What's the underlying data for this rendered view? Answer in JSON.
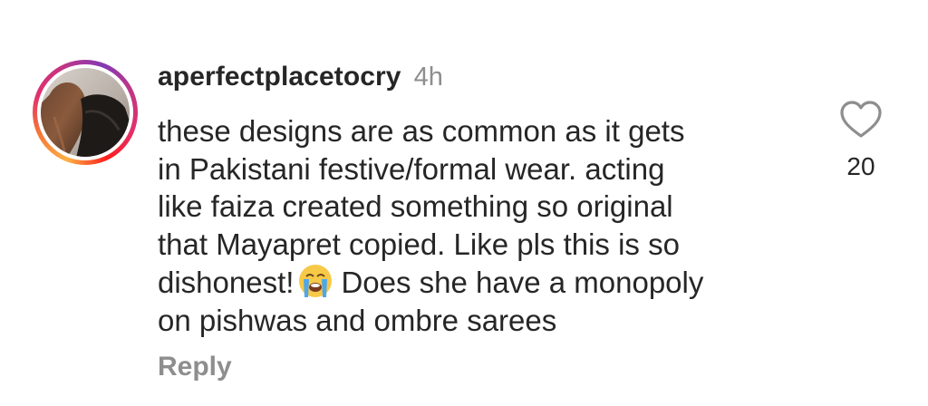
{
  "comment": {
    "username": "aperfectplacetocry",
    "time": "4h",
    "lines": [
      "these designs are as common as it gets",
      "in Pakistani festive/formal wear. acting",
      "like faiza created something so original",
      "that Mayapret copied. Like pls this is so",
      "dishonest!",
      "Does she have a monopoly",
      "on pishwas and ombre sarees"
    ],
    "emoji_name": "loudly-crying-face-icon",
    "reply_label": "Reply",
    "like_count": "20",
    "like_icon": "heart-outline-icon"
  },
  "colors": {
    "text": "#262626",
    "muted": "#8e8e8e",
    "background": "#ffffff",
    "story_ring": [
      "#fcaf45",
      "#f77737",
      "#e1306c",
      "#c13584",
      "#833ab4"
    ]
  }
}
